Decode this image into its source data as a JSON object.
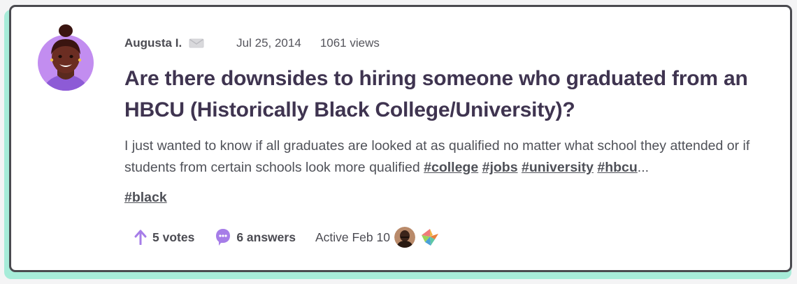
{
  "post": {
    "author": "Augusta I.",
    "date": "Jul 25, 2014",
    "views": "1061 views",
    "title": "Are there downsides to hiring someone who graduated from an HBCU (Historically Black College/University)?",
    "excerpt": "I just wanted to know if all graduates are looked at as qualified no matter what school they attended or if students from certain schools look more qualified",
    "inline_tags": [
      "#college",
      "#jobs",
      "#university",
      "#hbcu"
    ],
    "ellipsis": "...",
    "extra_tags": [
      "#black"
    ]
  },
  "footer": {
    "votes": "5 votes",
    "answers": "6 answers",
    "active": "Active Feb 10"
  },
  "colors": {
    "accent_purple": "#a67de8",
    "title": "#3f3450",
    "card_shadow": "#a7ecd9",
    "card_border": "#4a4a4f"
  },
  "icons": {
    "mail": "envelope-icon",
    "upvote": "arrow-up-icon",
    "answers": "speech-bubble-icon"
  }
}
